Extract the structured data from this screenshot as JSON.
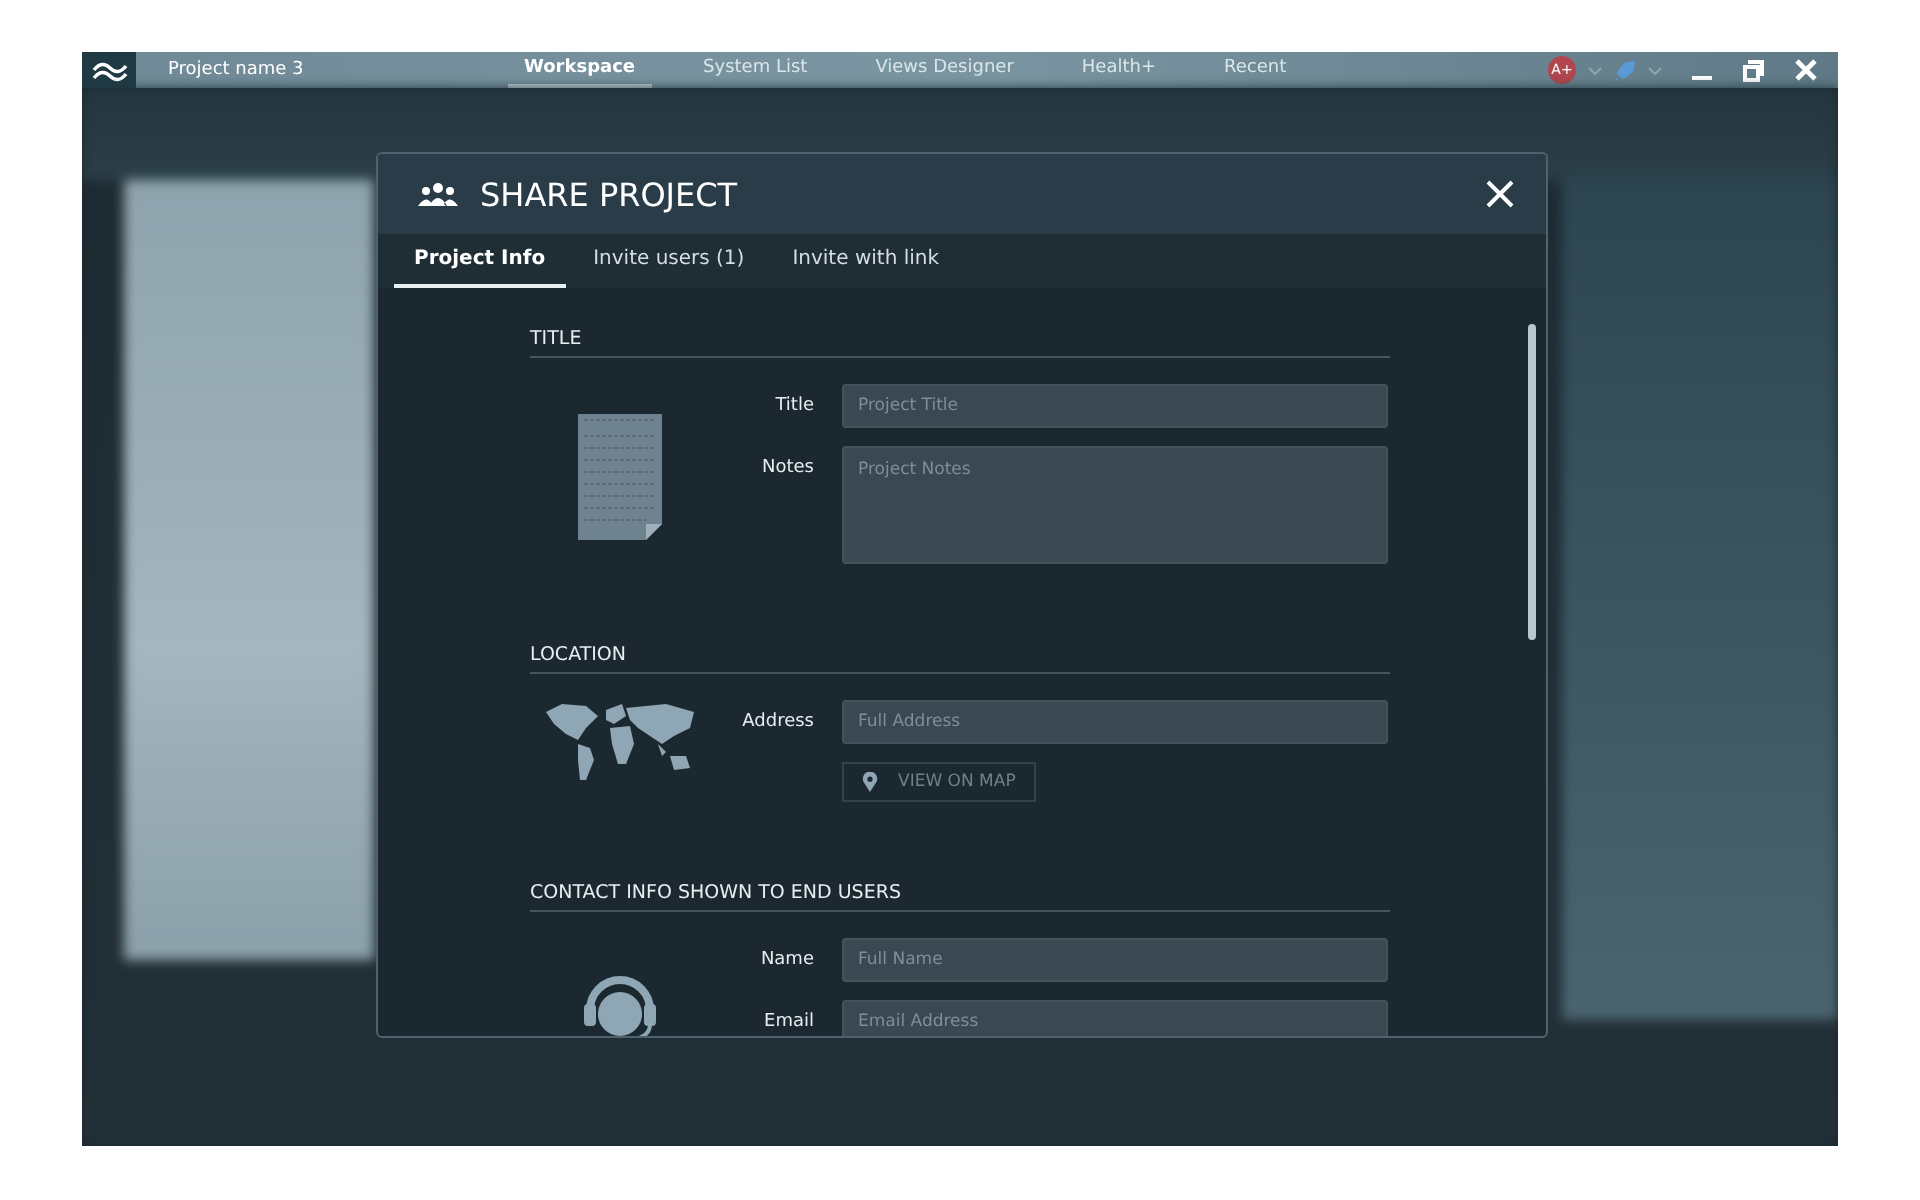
{
  "app": {
    "project_name": "Project name 3",
    "user_badge": "A+",
    "tabs": [
      {
        "label": "Workspace",
        "selected": true
      },
      {
        "label": "System List",
        "selected": false
      },
      {
        "label": "Views Designer",
        "selected": false
      },
      {
        "label": "Health+",
        "selected": false
      },
      {
        "label": "Recent",
        "selected": false
      }
    ]
  },
  "dialog": {
    "title": "SHARE PROJECT",
    "tabs": [
      {
        "label": "Project Info",
        "selected": true
      },
      {
        "label": "Invite users (1)",
        "selected": false
      },
      {
        "label": "Invite with link",
        "selected": false
      }
    ],
    "sections": [
      {
        "kind": "title",
        "heading": "TITLE",
        "fields": [
          {
            "kind": "line",
            "label": "Title",
            "placeholder": "Project Title"
          },
          {
            "kind": "area",
            "label": "Notes",
            "placeholder": "Project Notes"
          }
        ]
      },
      {
        "kind": "location",
        "heading": "LOCATION",
        "fields": [
          {
            "kind": "line",
            "label": "Address",
            "placeholder": "Full Address"
          }
        ],
        "button": "VIEW ON MAP"
      },
      {
        "kind": "contact",
        "heading": "CONTACT INFO SHOWN TO END USERS",
        "fields": [
          {
            "kind": "line",
            "label": "Name",
            "placeholder": "Full Name"
          },
          {
            "kind": "line",
            "label": "Email",
            "placeholder": "Email Address"
          }
        ]
      }
    ]
  }
}
